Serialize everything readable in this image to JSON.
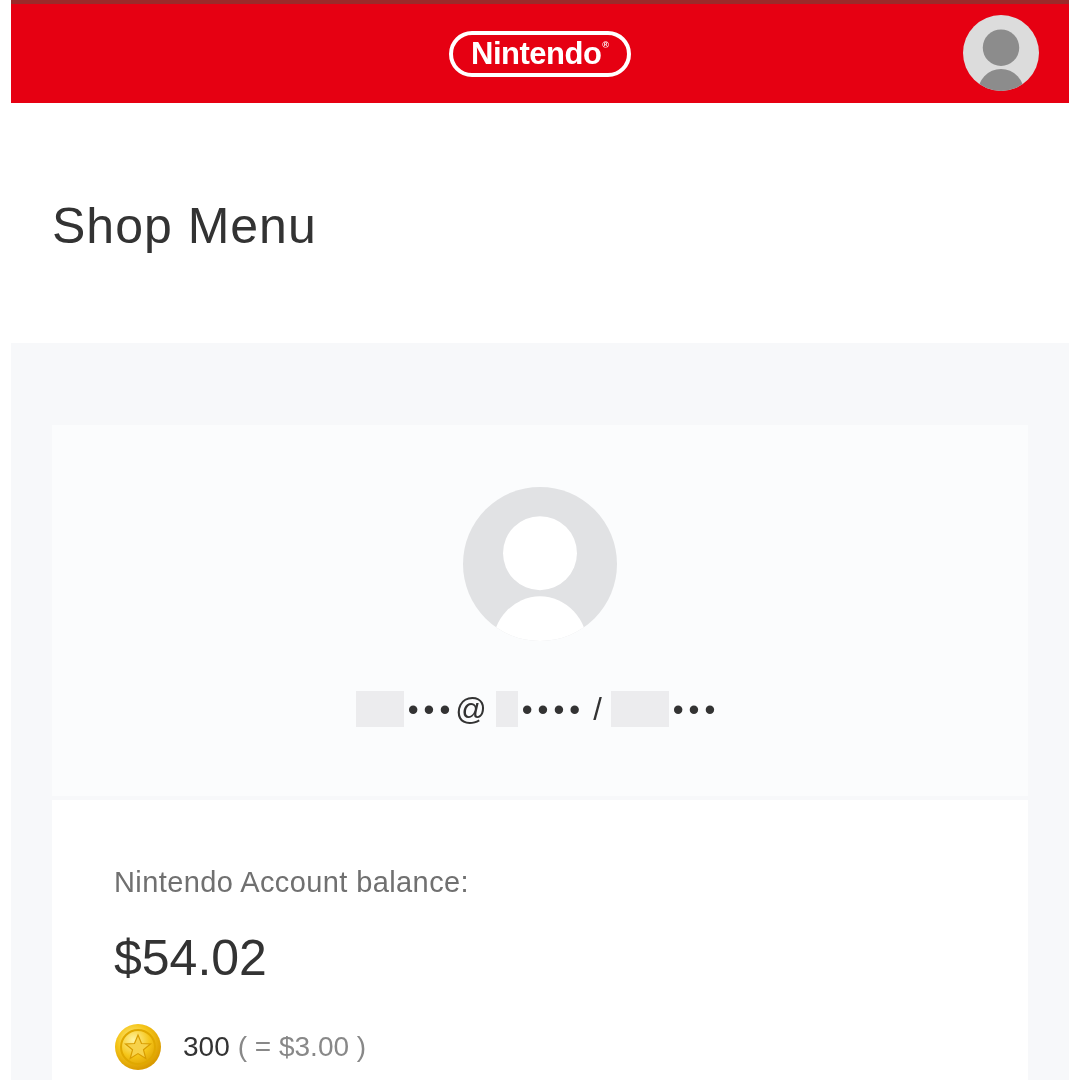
{
  "header": {
    "logo": {
      "text": "Nintendo",
      "mark": "®"
    }
  },
  "page_title": "Shop Menu",
  "profile": {
    "account_id": [
      {
        "kind": "redacted"
      },
      {
        "kind": "text",
        "text": "•••@"
      },
      {
        "kind": "redacted"
      },
      {
        "kind": "text",
        "text": "••••"
      },
      {
        "kind": "text",
        "text": "/"
      },
      {
        "kind": "redacted"
      },
      {
        "kind": "text",
        "text": "•••"
      }
    ]
  },
  "balance": {
    "label": "Nintendo Account balance:",
    "amount": "$54.02",
    "points": "300",
    "points_value": "( = $3.00 )"
  }
}
